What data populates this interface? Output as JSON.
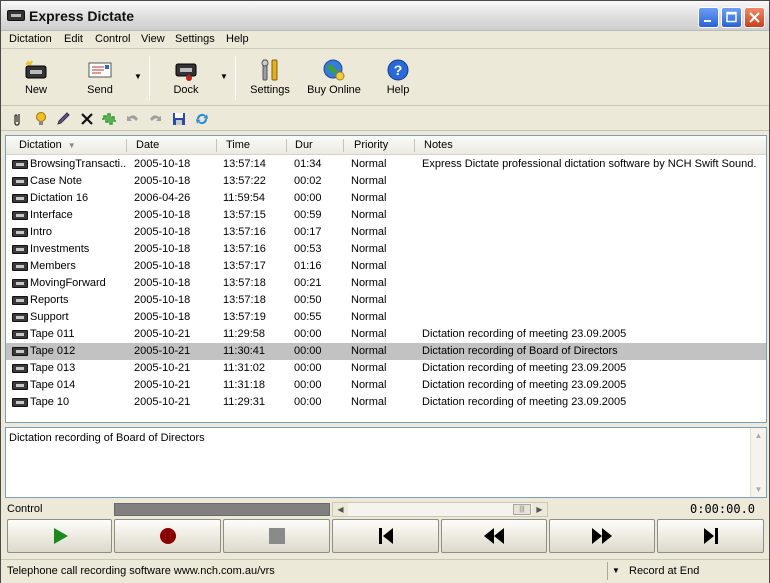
{
  "window": {
    "title": "Express Dictate"
  },
  "menu": [
    "Dictation",
    "Edit",
    "Control",
    "View",
    "Settings",
    "Help"
  ],
  "toolbar": {
    "new_label": "New",
    "send_label": "Send",
    "dock_label": "Dock",
    "settings_label": "Settings",
    "buy_label": "Buy Online",
    "help_label": "Help"
  },
  "list": {
    "columns": [
      "Dictation",
      "Date",
      "Time",
      "Dur",
      "Priority",
      "Notes"
    ],
    "rows": [
      {
        "name": "BrowsingTransacti...",
        "date": "2005-10-18",
        "time": "13:57:14",
        "dur": "01:34",
        "priority": "Normal",
        "notes": "Express Dictate professional dictation software by NCH Swift Sound."
      },
      {
        "name": "Case Note",
        "date": "2005-10-18",
        "time": "13:57:22",
        "dur": "00:02",
        "priority": "Normal",
        "notes": ""
      },
      {
        "name": "Dictation 16",
        "date": "2006-04-26",
        "time": "11:59:54",
        "dur": "00:00",
        "priority": "Normal",
        "notes": ""
      },
      {
        "name": "Interface",
        "date": "2005-10-18",
        "time": "13:57:15",
        "dur": "00:59",
        "priority": "Normal",
        "notes": ""
      },
      {
        "name": "Intro",
        "date": "2005-10-18",
        "time": "13:57:16",
        "dur": "00:17",
        "priority": "Normal",
        "notes": ""
      },
      {
        "name": "Investments",
        "date": "2005-10-18",
        "time": "13:57:16",
        "dur": "00:53",
        "priority": "Normal",
        "notes": ""
      },
      {
        "name": "Members",
        "date": "2005-10-18",
        "time": "13:57:17",
        "dur": "01:16",
        "priority": "Normal",
        "notes": ""
      },
      {
        "name": "MovingForward",
        "date": "2005-10-18",
        "time": "13:57:18",
        "dur": "00:21",
        "priority": "Normal",
        "notes": ""
      },
      {
        "name": "Reports",
        "date": "2005-10-18",
        "time": "13:57:18",
        "dur": "00:50",
        "priority": "Normal",
        "notes": ""
      },
      {
        "name": "Support",
        "date": "2005-10-18",
        "time": "13:57:19",
        "dur": "00:55",
        "priority": "Normal",
        "notes": ""
      },
      {
        "name": "Tape 011",
        "date": "2005-10-21",
        "time": "11:29:58",
        "dur": "00:00",
        "priority": "Normal",
        "notes": "Dictation recording of meeting  23.09.2005"
      },
      {
        "name": "Tape 012",
        "date": "2005-10-21",
        "time": "11:30:41",
        "dur": "00:00",
        "priority": "Normal",
        "notes": "Dictation recording of Board of Directors"
      },
      {
        "name": "Tape 013",
        "date": "2005-10-21",
        "time": "11:31:02",
        "dur": "00:00",
        "priority": "Normal",
        "notes": "Dictation recording of meeting  23.09.2005"
      },
      {
        "name": "Tape 014",
        "date": "2005-10-21",
        "time": "11:31:18",
        "dur": "00:00",
        "priority": "Normal",
        "notes": "Dictation recording of meeting  23.09.2005"
      },
      {
        "name": "Tape 10",
        "date": "2005-10-21",
        "time": "11:29:31",
        "dur": "00:00",
        "priority": "Normal",
        "notes": "Dictation recording of meeting  23.09.2005"
      }
    ],
    "selected_index": 11
  },
  "notes_pane": {
    "text": "Dictation recording of Board of Directors"
  },
  "control": {
    "label": "Control",
    "time": "0:00:00.0"
  },
  "status": {
    "left": "Telephone call recording software www.nch.com.au/vrs",
    "right": "Record at End"
  },
  "colors": {
    "selected_row": "#c2c2c2",
    "play_green": "#1a8a1a",
    "record_red": "#8b0000"
  }
}
